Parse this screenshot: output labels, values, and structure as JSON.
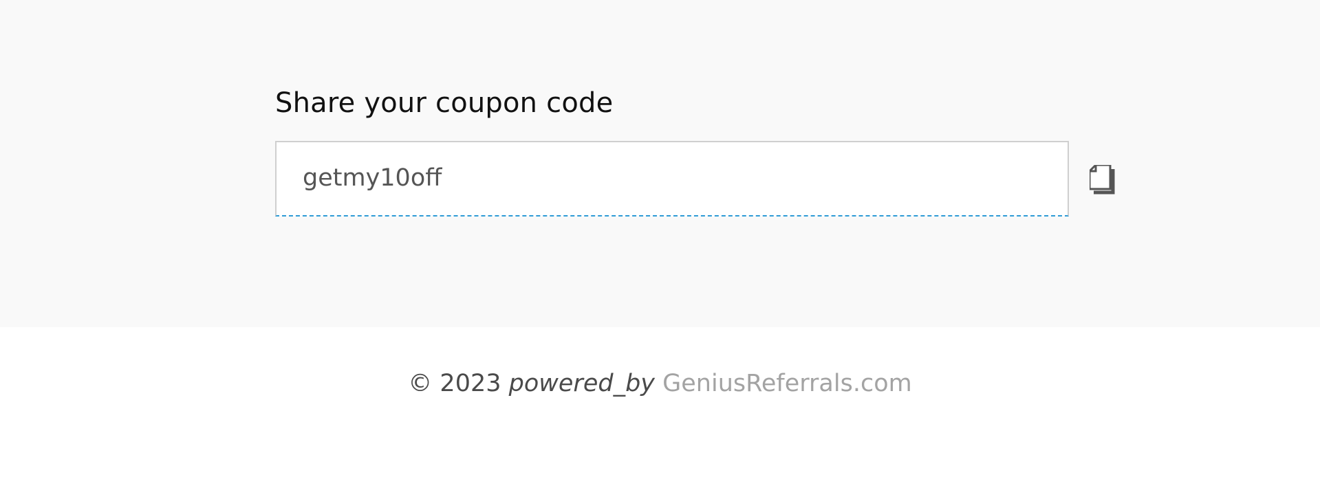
{
  "share": {
    "title": "Share your coupon code",
    "coupon_code": "getmy10off",
    "copy_icon": "copy-icon"
  },
  "footer": {
    "copyright": "© 2023",
    "powered_by": "powered_by",
    "brand_link": "GeniusReferrals.com"
  },
  "colors": {
    "panel_background": "#f9f9f9",
    "field_border": "#cfcfcf",
    "field_focus_underline": "#2e9bd6",
    "link_text": "#a3a3a3"
  }
}
